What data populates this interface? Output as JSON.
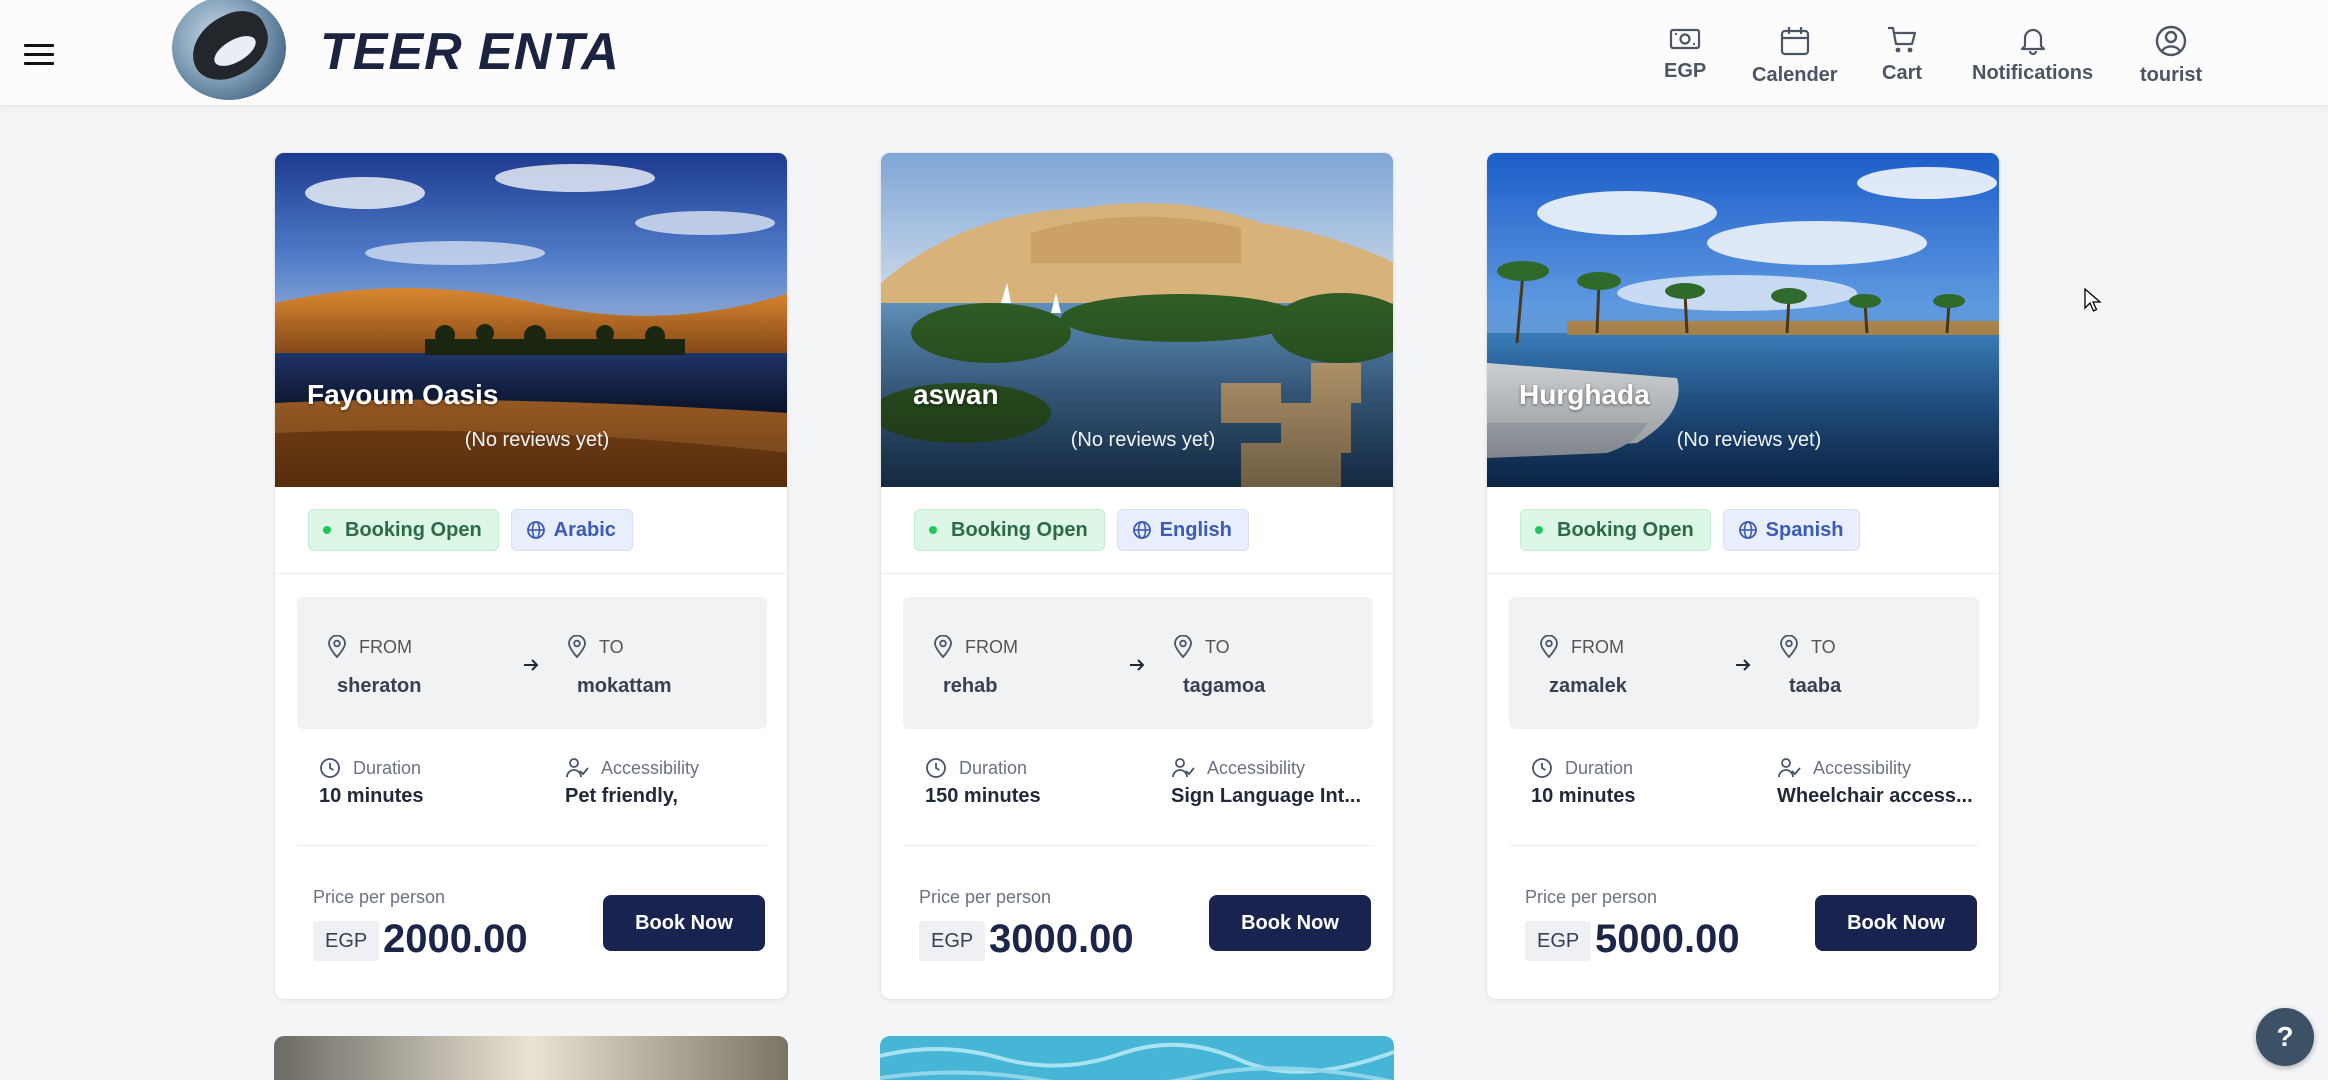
{
  "header": {
    "brand": "TEER ENTA",
    "nav": [
      {
        "label": "EGP",
        "icon": "currency-icon"
      },
      {
        "label": "Calender",
        "icon": "calendar-icon"
      },
      {
        "label": "Cart",
        "icon": "cart-icon"
      },
      {
        "label": "Notifications",
        "icon": "bell-icon"
      },
      {
        "label": "tourist",
        "icon": "user-circle-icon"
      }
    ]
  },
  "cards": [
    {
      "title": "Fayoum Oasis",
      "reviews": "(No reviews yet)",
      "status": "Booking Open",
      "language": "Arabic",
      "from_label": "FROM",
      "to_label": "TO",
      "from": "sheraton",
      "to": "mokattam",
      "duration_label": "Duration",
      "duration": "10 minutes",
      "accessibility_label": "Accessibility",
      "accessibility": "Pet friendly,",
      "price_label": "Price per person",
      "currency": "EGP",
      "price": "2000.00",
      "button": "Book Now"
    },
    {
      "title": "aswan",
      "reviews": "(No reviews yet)",
      "status": "Booking Open",
      "language": "English",
      "from_label": "FROM",
      "to_label": "TO",
      "from": "rehab",
      "to": "tagamoa",
      "duration_label": "Duration",
      "duration": "150 minutes",
      "accessibility_label": "Accessibility",
      "accessibility": "Sign Language Int...",
      "price_label": "Price per person",
      "currency": "EGP",
      "price": "3000.00",
      "button": "Book Now"
    },
    {
      "title": "Hurghada",
      "reviews": "(No reviews yet)",
      "status": "Booking Open",
      "language": "Spanish",
      "from_label": "FROM",
      "to_label": "TO",
      "from": "zamalek",
      "to": "taaba",
      "duration_label": "Duration",
      "duration": "10 minutes",
      "accessibility_label": "Accessibility",
      "accessibility": "Wheelchair access...",
      "price_label": "Price per person",
      "currency": "EGP",
      "price": "5000.00",
      "button": "Book Now"
    }
  ],
  "help": "?"
}
